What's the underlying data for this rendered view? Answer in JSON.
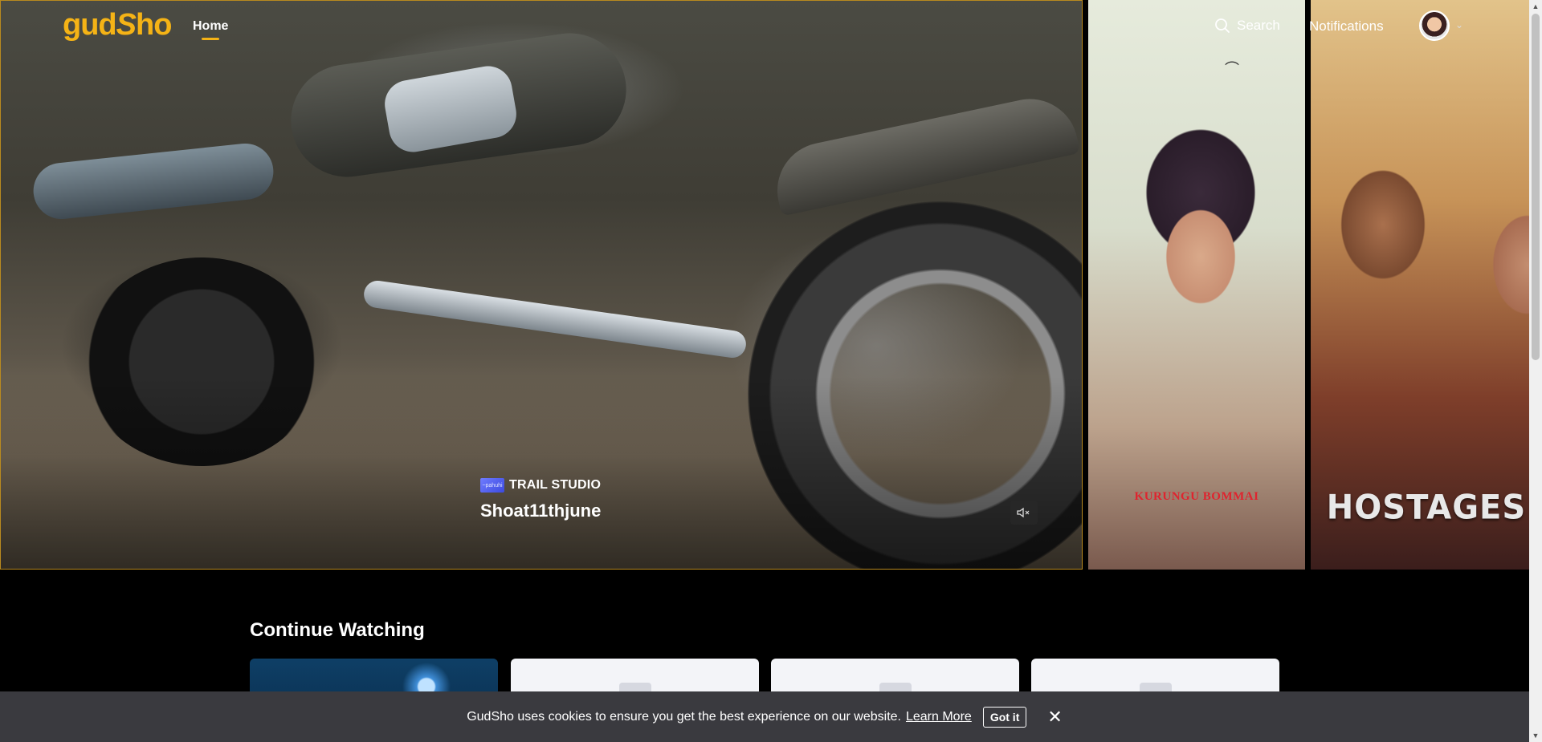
{
  "brand": {
    "logo_text_a": "gud",
    "logo_text_s": "S",
    "logo_text_b": "ho",
    "accent": "#f5b316"
  },
  "nav": {
    "home_label": "Home",
    "search_label": "Search",
    "notifications_label": "Notifications"
  },
  "hero": {
    "studio_logo_text": "~pahuhi",
    "studio_name": "TRAIL STUDIO",
    "video_title": "Shoat11thjune",
    "posters": [
      {
        "title": "KURUNGU BOMMAI"
      },
      {
        "title": "HOSTAGES"
      }
    ]
  },
  "continue_watching": {
    "title": "Continue Watching"
  },
  "cookie": {
    "text": "GudSho uses cookies to ensure you get the best experience on our website.",
    "learn_more": "Learn More",
    "got_it": "Got it",
    "close_glyph": "✕"
  }
}
